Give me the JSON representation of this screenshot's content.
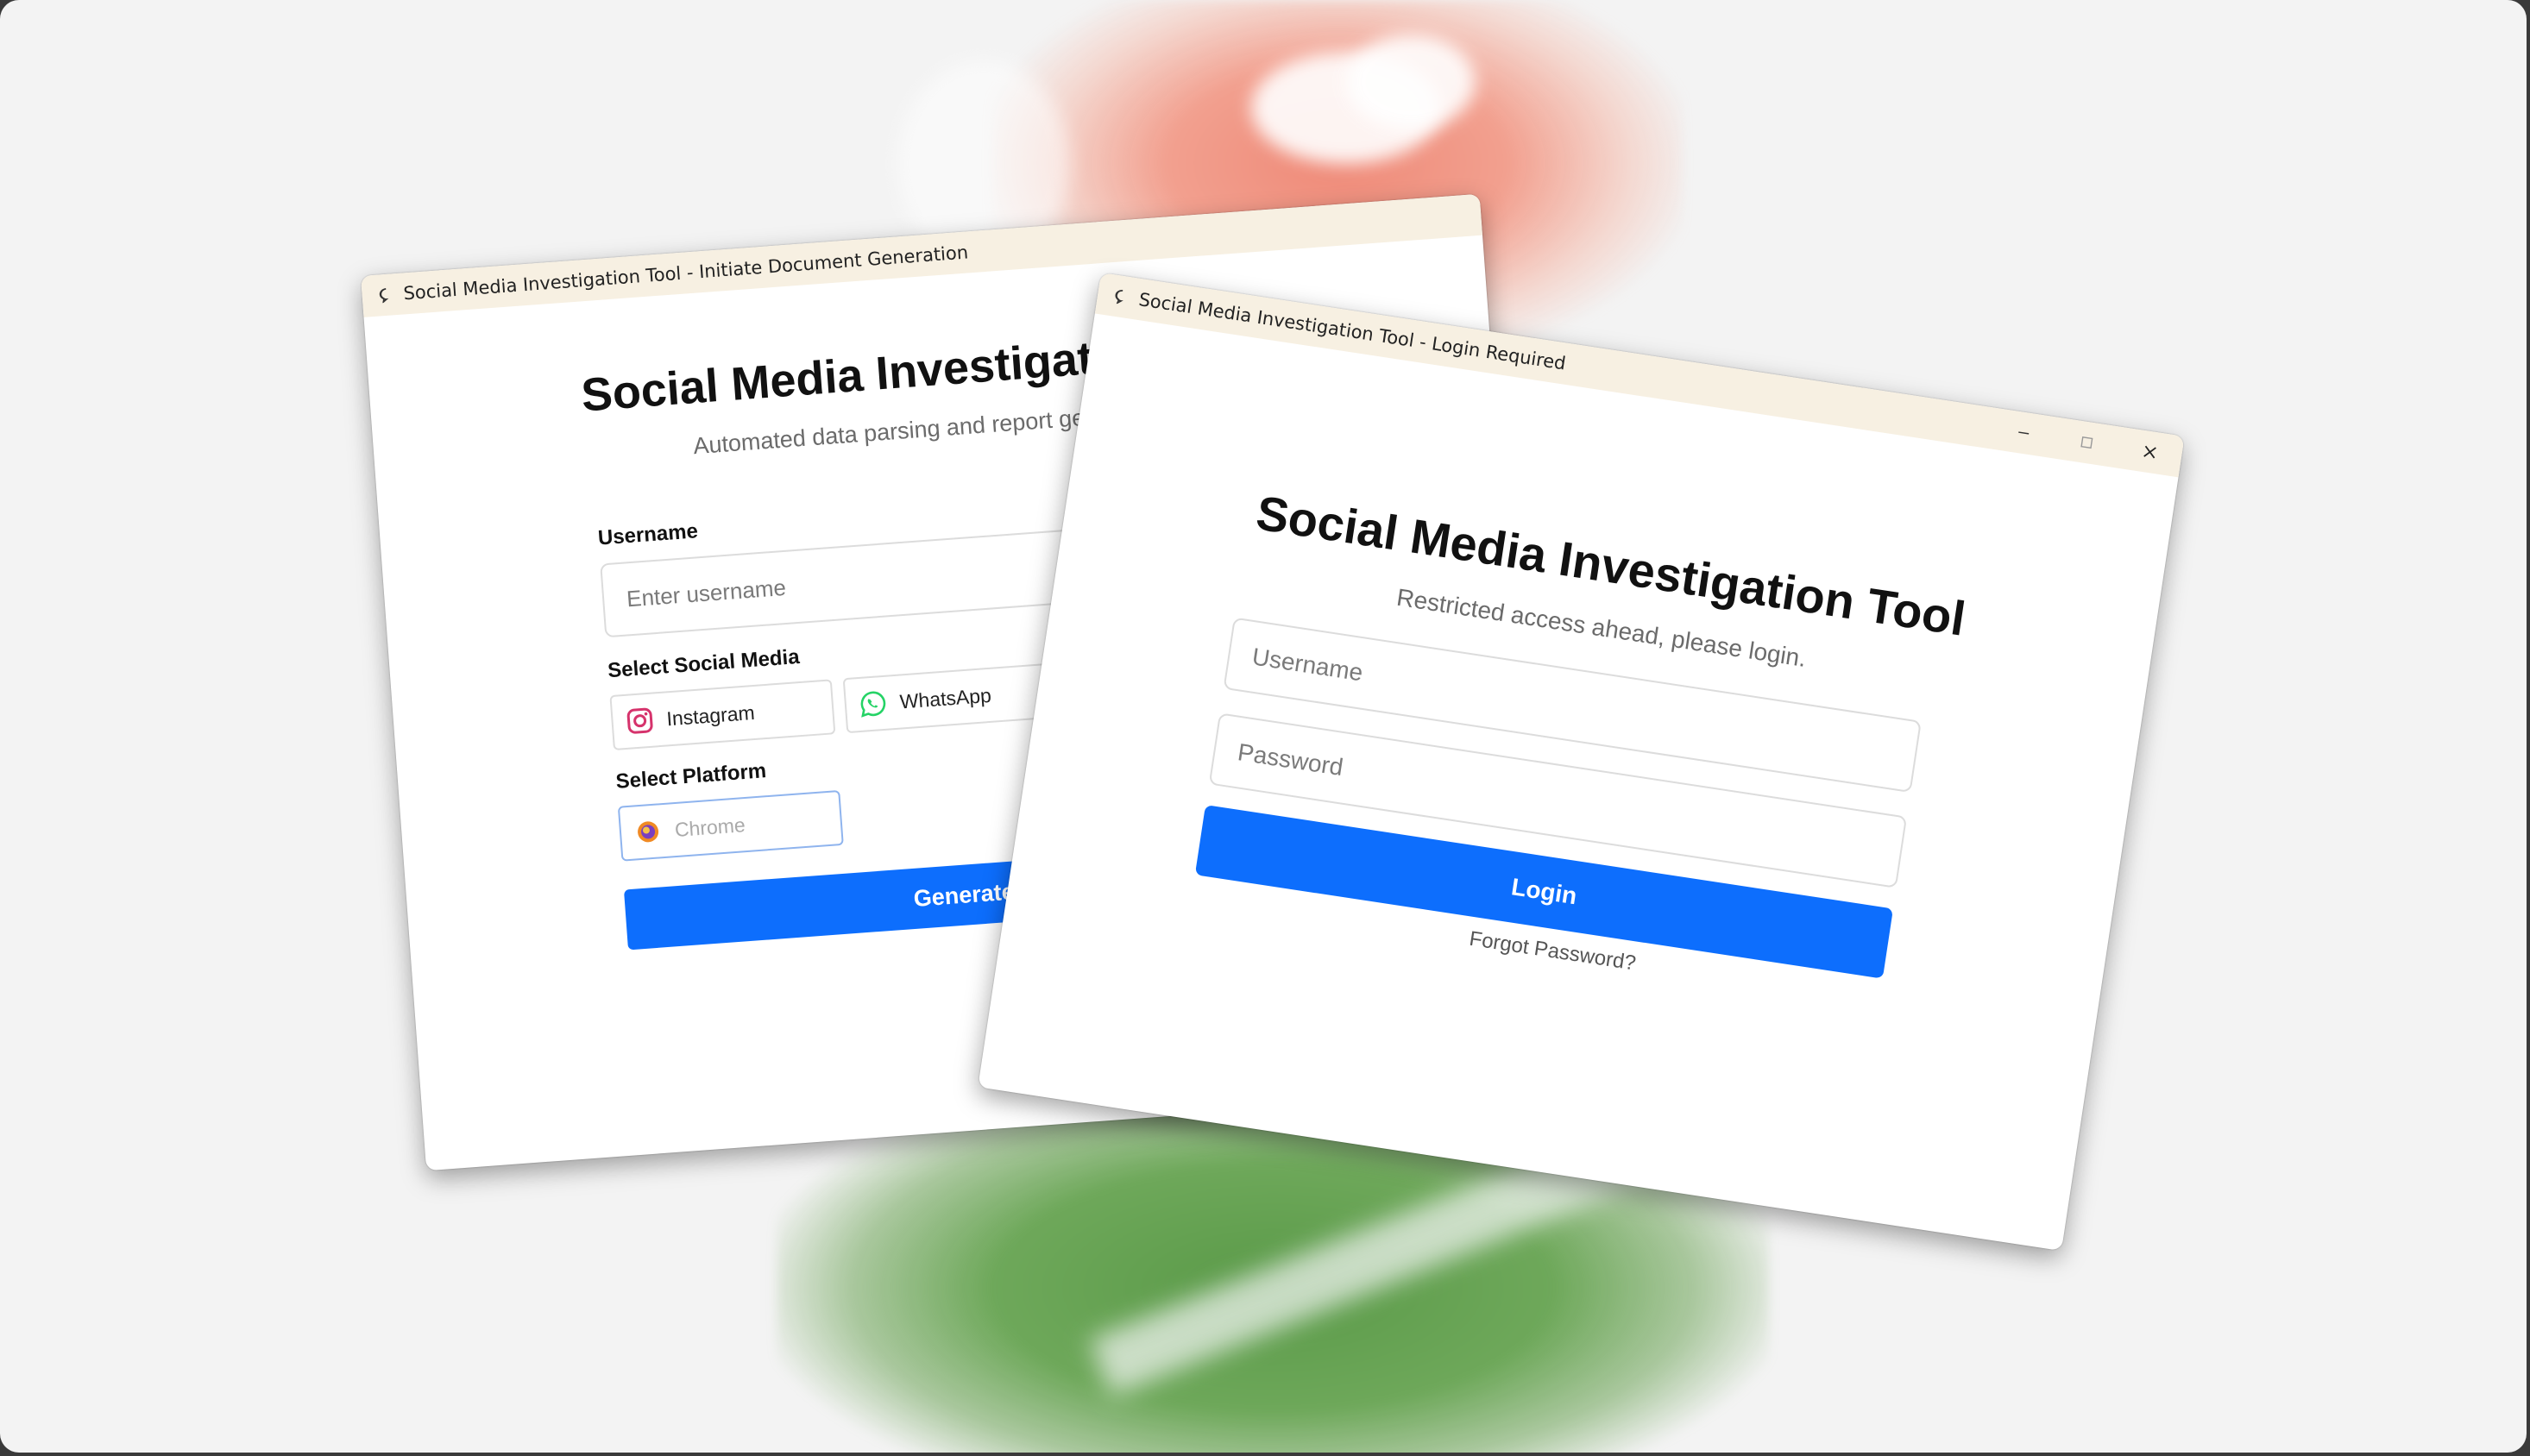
{
  "windows": {
    "report": {
      "title": "Social Media Investigation Tool - Initiate Document Generation",
      "heading": "Social Media Investigation Tool",
      "subtitle": "Automated data parsing and report generation",
      "username_label": "Username",
      "username_placeholder": "Enter username",
      "social_label": "Select Social Media",
      "social_options": [
        {
          "label": "Instagram",
          "icon": "instagram-icon"
        },
        {
          "label": "WhatsApp",
          "icon": "whatsapp-icon"
        }
      ],
      "platform_label": "Select Platform",
      "platform_value": "Chrome",
      "generate_button": "Generate Report"
    },
    "login": {
      "title": "Social Media Investigation Tool - Login Required",
      "heading": "Social Media Investigation Tool",
      "subtitle": "Restricted access ahead, please login.",
      "username_placeholder": "Username",
      "password_placeholder": "Password",
      "login_button": "Login",
      "forgot_link": "Forgot Password?"
    }
  },
  "colors": {
    "primary": "#0d6efd",
    "titlebar": "#f7f0e2",
    "instagram": "#d6336c",
    "whatsapp": "#25d366"
  }
}
